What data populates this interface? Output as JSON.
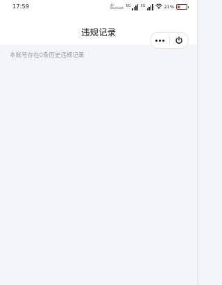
{
  "status_bar": {
    "time": "17:59",
    "network_type": "4G",
    "network_subtype": "Bluetooth",
    "sim1_label": "5G",
    "sim2_label": "5G",
    "battery_text": "21%",
    "battery_level_percent": 21,
    "battery_fill_color": "#e23a3a",
    "wifi_icon": "wifi-icon"
  },
  "header": {
    "title": "违规记录",
    "more_icon": "more-dots-icon",
    "close_icon": "power-icon"
  },
  "main": {
    "message": "本账号存在0条历史违规记录"
  },
  "colors": {
    "page_background": "#f4f5fa",
    "header_background": "#ffffff",
    "message_text": "#9a9ca4"
  }
}
